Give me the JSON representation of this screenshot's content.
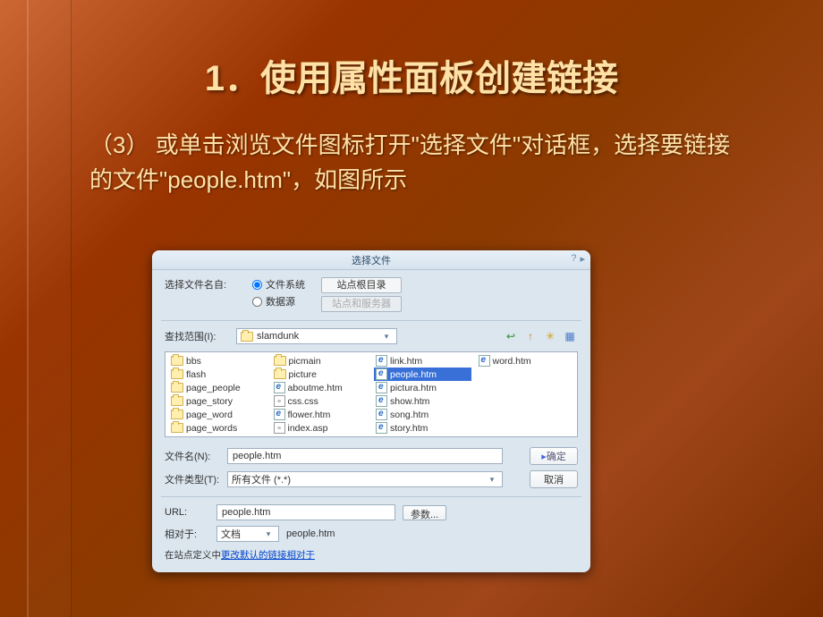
{
  "slide": {
    "title": "1．使用属性面板创建链接",
    "body": "（3） 或单击浏览文件图标打开\"选择文件\"对话框，选择要链接的文件\"people.htm\"，如图所示"
  },
  "dialog": {
    "title": "选择文件",
    "help_icon": "?",
    "expand_icon": "▸",
    "source_label": "选择文件名自:",
    "radio_fs": "文件系统",
    "radio_ds": "数据源",
    "tab_root": "站点根目录",
    "tab_server": "站点和服务器",
    "lookup_label": "查找范围(I):",
    "lookup_value": "slamdunk",
    "tool_back": "↩",
    "tool_up": "↑",
    "tool_new": "✳",
    "tool_view": "▦",
    "files": {
      "col1": [
        {
          "icon": "folder",
          "name": "bbs"
        },
        {
          "icon": "folder",
          "name": "flash"
        },
        {
          "icon": "folder",
          "name": "page_people"
        },
        {
          "icon": "folder",
          "name": "page_story"
        },
        {
          "icon": "folder",
          "name": "page_word"
        },
        {
          "icon": "folder",
          "name": "page_words"
        }
      ],
      "col2": [
        {
          "icon": "folder",
          "name": "picmain"
        },
        {
          "icon": "folder",
          "name": "picture"
        },
        {
          "icon": "ie",
          "name": "aboutme.htm"
        },
        {
          "icon": "css",
          "name": "css.css"
        },
        {
          "icon": "ie",
          "name": "flower.htm"
        },
        {
          "icon": "css",
          "name": "index.asp"
        }
      ],
      "col3": [
        {
          "icon": "ie",
          "name": "link.htm"
        },
        {
          "icon": "ie",
          "name": "people.htm",
          "selected": true
        },
        {
          "icon": "ie",
          "name": "pictura.htm"
        },
        {
          "icon": "ie",
          "name": "show.htm"
        },
        {
          "icon": "ie",
          "name": "song.htm"
        },
        {
          "icon": "ie",
          "name": "story.htm"
        }
      ],
      "col4": [
        {
          "icon": "ie",
          "name": "word.htm"
        }
      ]
    },
    "filename_label": "文件名(N):",
    "filename_value": "people.htm",
    "filetype_label": "文件类型(T):",
    "filetype_value": "所有文件 (*.*)",
    "ok_label": "确定",
    "cancel_label": "取消",
    "url_label": "URL:",
    "url_value": "people.htm",
    "params_label": "参数...",
    "relative_label": "相对于:",
    "relative_value": "文档",
    "relative_file": "people.htm",
    "footer_prefix": "在站点定义中",
    "footer_link": "更改默认的链接相对于"
  }
}
